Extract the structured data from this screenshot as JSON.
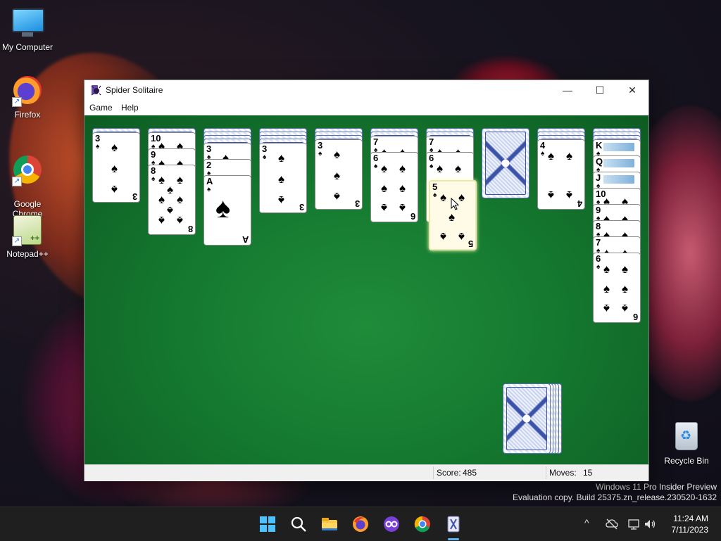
{
  "desktop": {
    "icons": [
      {
        "label": "My Computer"
      },
      {
        "label": "Firefox"
      },
      {
        "label": "Google\nChrome"
      },
      {
        "label": "Notepad++"
      },
      {
        "label": "Recycle Bin"
      }
    ],
    "watermark": {
      "line1": "Windows 11 Pro Insider Preview",
      "line2": "Evaluation copy. Build 25375.zn_release.230520-1632"
    }
  },
  "window": {
    "title": "Spider Solitaire",
    "controls": {
      "minimize": "—",
      "maximize": "☐",
      "close": "✕"
    },
    "menu": [
      "Game",
      "Help"
    ],
    "status": {
      "score_label": "Score:",
      "score": "485",
      "moves_label": "Moves:",
      "moves": "15"
    }
  },
  "game": {
    "suit": "♠",
    "columns": [
      {
        "face_down": 1,
        "face_up": [
          "3"
        ]
      },
      {
        "face_down": 1,
        "face_up": [
          "10",
          "9",
          "8"
        ]
      },
      {
        "face_down": 4,
        "face_up": [
          "3",
          "2",
          "A"
        ]
      },
      {
        "face_down": 4,
        "face_up": [
          "3"
        ]
      },
      {
        "face_down": 3,
        "face_up": [
          "3"
        ]
      },
      {
        "face_down": 2,
        "face_up": [
          "7",
          "6"
        ]
      },
      {
        "face_down": 2,
        "face_up": [
          "7",
          "6"
        ],
        "dragging": "5"
      },
      {
        "face_down": 1,
        "face_up": []
      },
      {
        "face_down": 3,
        "face_up": [
          "4"
        ]
      },
      {
        "face_down": 3,
        "face_up": [
          "K",
          "Q",
          "J",
          "10",
          "9",
          "8",
          "7",
          "6"
        ]
      }
    ],
    "stock_piles": 5
  },
  "taskbar": {
    "apps": [
      "start",
      "search",
      "file-explorer",
      "firefox",
      "media-player",
      "chrome",
      "spider-solitaire"
    ],
    "tray": {
      "chevron": "^",
      "network": "⛁",
      "volume": "🔊"
    },
    "clock": {
      "time": "11:24 AM",
      "date": "7/11/2023"
    }
  }
}
